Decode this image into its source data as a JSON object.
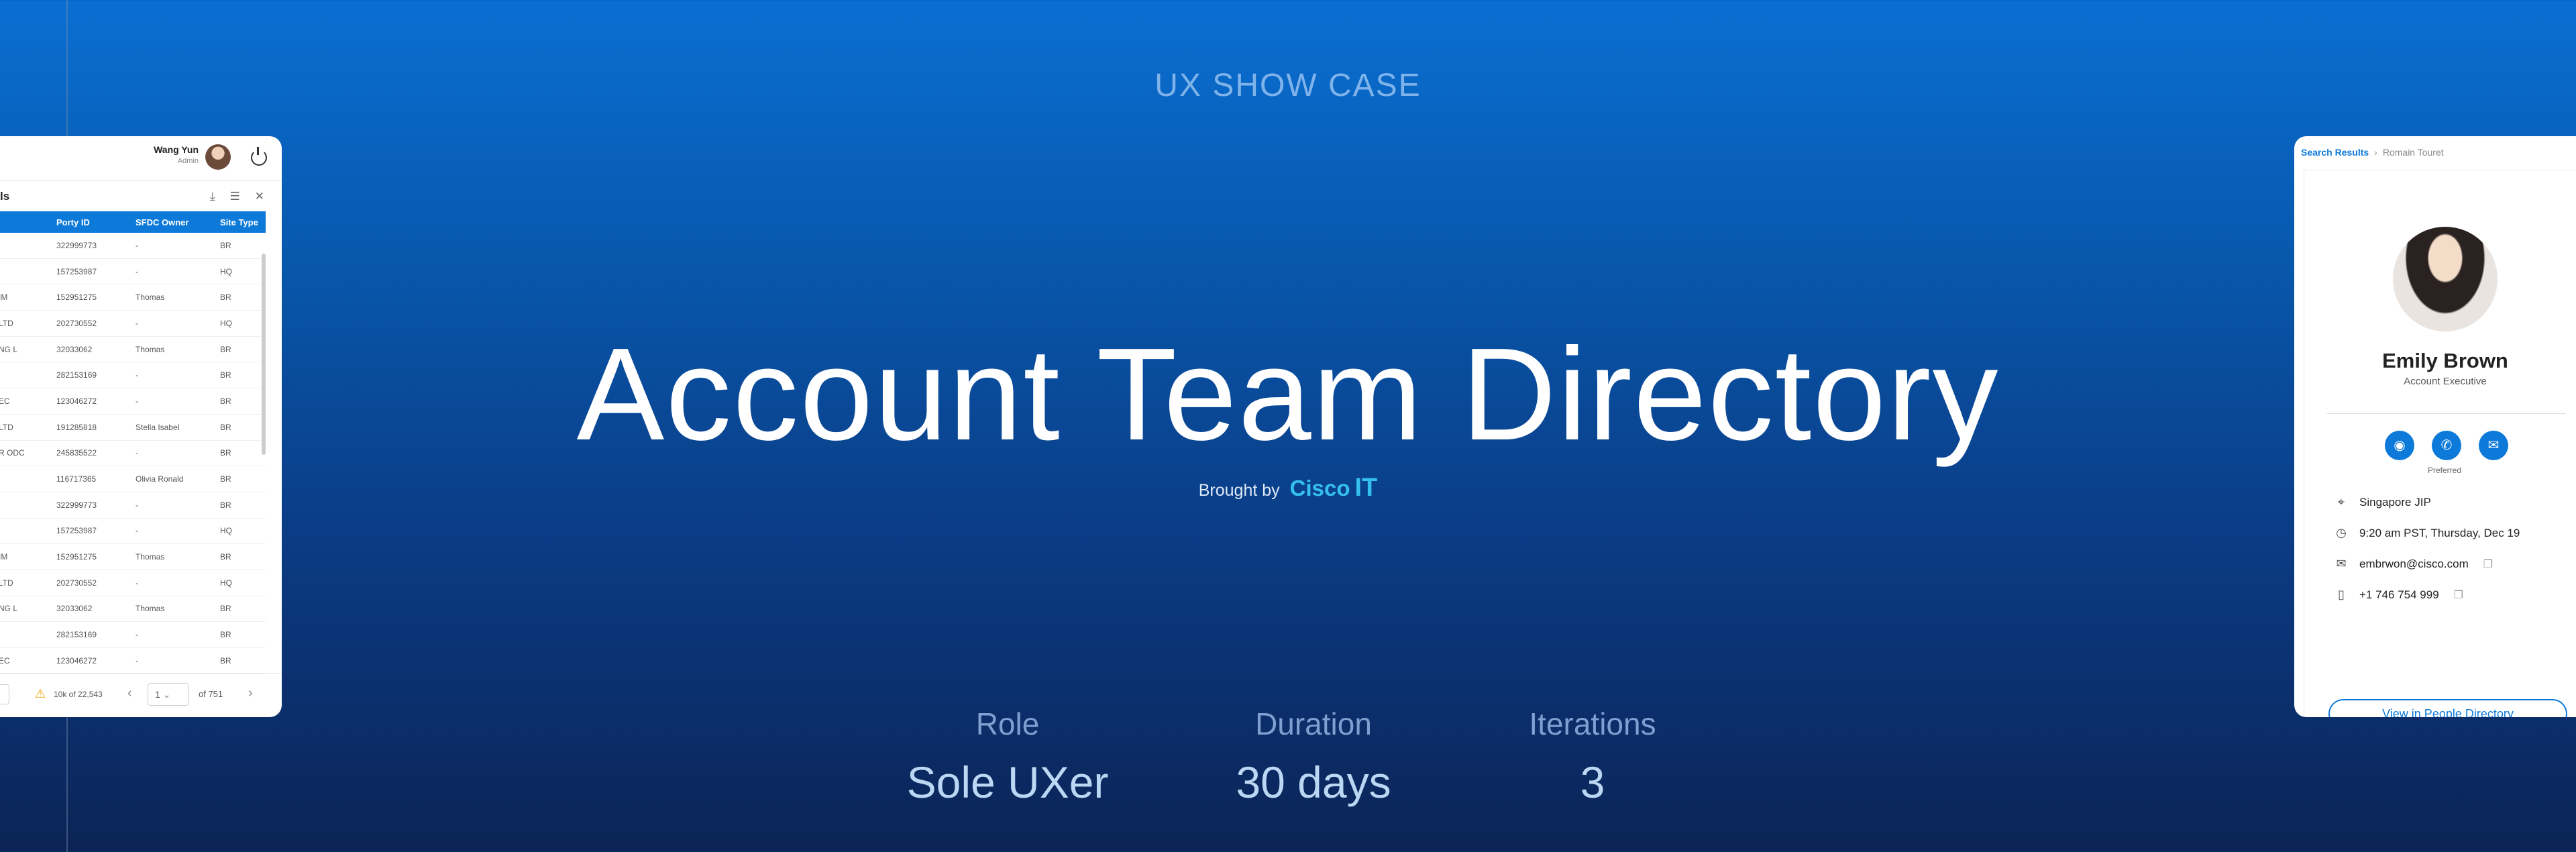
{
  "hero": {
    "eyebrow": "UX SHOW CASE",
    "title": "Account Team Directory",
    "brought_by": "Brought by",
    "brand_cisco": "Cisco",
    "brand_it": "IT"
  },
  "stats": [
    {
      "label": "Role",
      "value": "Sole UXer"
    },
    {
      "label": "Duration",
      "value": "30 days"
    },
    {
      "label": "Iterations",
      "value": "3"
    }
  ],
  "left_card": {
    "user_name": "Wang Yun",
    "user_role": "Admin",
    "header_partial": "ls",
    "columns": [
      "",
      "Porty ID",
      "SFDC Owner",
      "Site Type"
    ],
    "rows": [
      [
        "",
        "322999773",
        "-",
        "BR"
      ],
      [
        "",
        "157253987",
        "-",
        "HQ"
      ],
      [
        "IM",
        "152951275",
        "Thomas",
        "BR"
      ],
      [
        "LTD",
        "202730552",
        "-",
        "HQ"
      ],
      [
        "NG L",
        "32033062",
        "Thomas",
        "BR"
      ],
      [
        "",
        "282153169",
        "-",
        "BR"
      ],
      [
        "EC",
        "123046272",
        "-",
        "BR"
      ],
      [
        "LTD",
        "191285818",
        "Stella Isabel",
        "BR"
      ],
      [
        "R ODC",
        "245835522",
        "-",
        "BR"
      ],
      [
        "",
        "116717365",
        "Olivia Ronald",
        "BR"
      ],
      [
        "",
        "322999773",
        "-",
        "BR"
      ],
      [
        "",
        "157253987",
        "-",
        "HQ"
      ],
      [
        "IM",
        "152951275",
        "Thomas",
        "BR"
      ],
      [
        "LTD",
        "202730552",
        "-",
        "HQ"
      ],
      [
        "NG L",
        "32033062",
        "Thomas",
        "BR"
      ],
      [
        "",
        "282153169",
        "-",
        "BR"
      ],
      [
        "EC",
        "123046272",
        "-",
        "BR"
      ]
    ],
    "footer": {
      "count": "10k of 22,543",
      "page": "1",
      "of_pages": "of 751"
    }
  },
  "right_card": {
    "breadcrumb_root": "Search Results",
    "breadcrumb_current": "Romain Touret",
    "name": "Emily Brown",
    "title": "Account Executive",
    "preferred_label": "Preferred",
    "location": "Singapore JIP",
    "time": "9:20 am PST, Thursday, Dec 19",
    "email": "embrwon@cisco.com",
    "phone": "+1 746 754 999",
    "view_button": "View in People Directory"
  },
  "colors": {
    "accent": "#0d7ad9",
    "brand_cyan": "#35c0f0"
  }
}
